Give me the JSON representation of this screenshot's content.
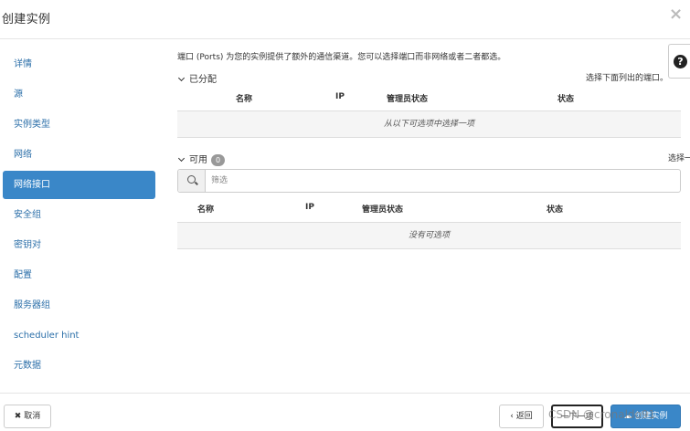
{
  "header": {
    "title": "创建实例",
    "close_symbol": "×"
  },
  "help": {
    "symbol": "?"
  },
  "sidebar": {
    "items": [
      {
        "label": "详情"
      },
      {
        "label": "源"
      },
      {
        "label": "实例类型"
      },
      {
        "label": "网络"
      },
      {
        "label": "网络接口",
        "active": true
      },
      {
        "label": "安全组"
      },
      {
        "label": "密钥对"
      },
      {
        "label": "配置"
      },
      {
        "label": "服务器组"
      },
      {
        "label": "scheduler hint"
      },
      {
        "label": "元数据"
      }
    ]
  },
  "main": {
    "description": "端口 (Ports) 为您的实例提供了额外的通信渠道。您可以选择端口而非网络或者二者都选。",
    "allocated": {
      "heading": "已分配",
      "hint": "选择下面列出的端口。",
      "columns": [
        "名称",
        "IP",
        "管理员状态",
        "状态"
      ],
      "empty_text": "从以下可选项中选择一项"
    },
    "available": {
      "heading": "可用",
      "count": "0",
      "hint": "选择一个",
      "filter_placeholder": "筛选",
      "filter_value": "",
      "columns": [
        "名称",
        "IP",
        "管理员状态",
        "状态"
      ],
      "empty_text": "没有可选项"
    }
  },
  "footer": {
    "cancel_label": "取消",
    "back_label": "‹ 返回",
    "next_label": "一下一项",
    "create_label": "创建实例"
  },
  "watermark": "CSDN @cronaldo91",
  "colors": {
    "accent": "#3a87c8",
    "link": "#2a6ea8"
  }
}
